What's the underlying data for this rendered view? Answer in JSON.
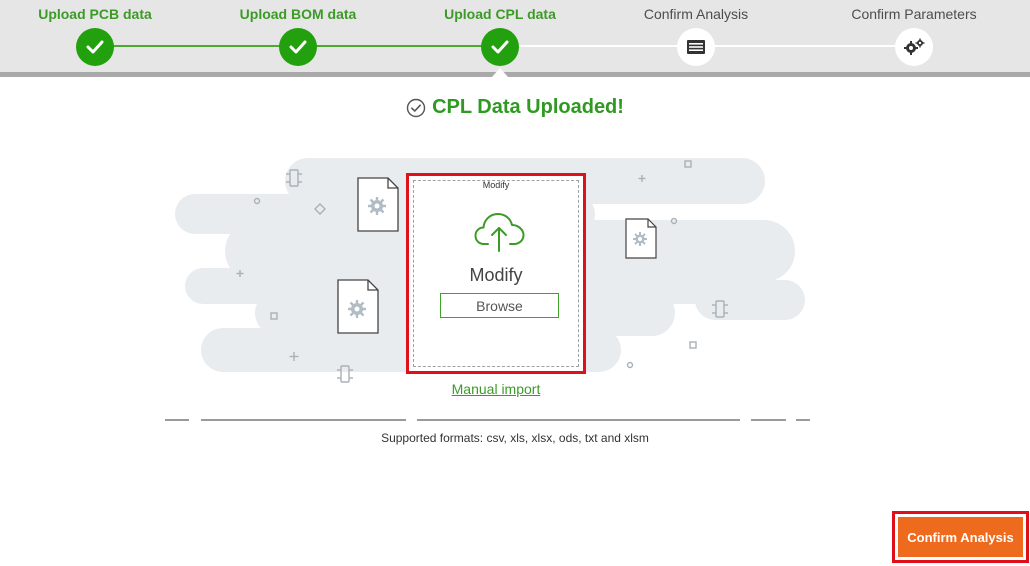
{
  "stepper": {
    "steps": [
      {
        "label": "Upload PCB data",
        "state": "done",
        "icon": "check-icon"
      },
      {
        "label": "Upload BOM data",
        "state": "done",
        "icon": "check-icon"
      },
      {
        "label": "Upload CPL data",
        "state": "done",
        "icon": "check-icon"
      },
      {
        "label": "Confirm Analysis",
        "state": "pending",
        "icon": "list-window-icon"
      },
      {
        "label": "Confirm Parameters",
        "state": "pending",
        "icon": "gears-icon"
      }
    ],
    "active_index": 2
  },
  "status": {
    "title": "CPL Data Uploaded!",
    "icon": "check-circle-icon"
  },
  "dropzone": {
    "caption": "Modify",
    "label": "Modify",
    "browse_label": "Browse",
    "icon": "cloud-upload-icon"
  },
  "manual_import_label": "Manual import",
  "supported_formats": "Supported formats: csv, xls, xlsx, ods, txt and xlsm",
  "footer": {
    "confirm_label": "Confirm Analysis"
  },
  "colors": {
    "accent_green": "#22a00d",
    "label_green": "#3c9b26",
    "confirm_orange": "#ee6b1e",
    "highlight_red": "#e0101a",
    "header_bg": "#e6e6e6"
  }
}
